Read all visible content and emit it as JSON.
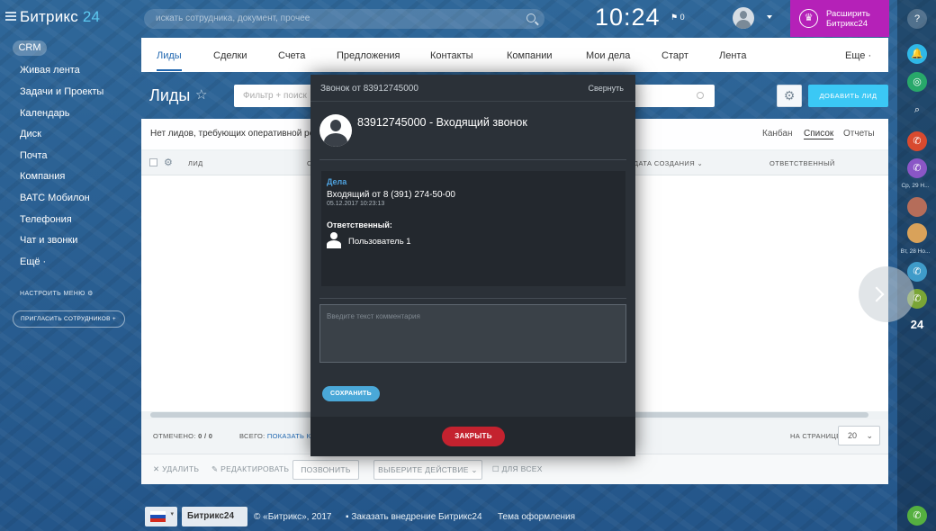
{
  "top_bar": {
    "logo_text": "Битрикс",
    "logo_num": "24",
    "search_placeholder": "искать сотрудника, документ, прочее",
    "clock": "10:24",
    "flag_count": "0",
    "upgrade_line1": "Расширить",
    "upgrade_line2": "Битрикс24",
    "upgrade_color": "#b521b8"
  },
  "sidebar": {
    "crm": "CRM",
    "items": [
      {
        "label": "Живая лента"
      },
      {
        "label": "Задачи и Проекты"
      },
      {
        "label": "Календарь"
      },
      {
        "label": "Диск"
      },
      {
        "label": "Почта"
      },
      {
        "label": "Компания"
      },
      {
        "label": "ВАТС Мобилон"
      },
      {
        "label": "Телефония"
      },
      {
        "label": "Чат и звонки"
      },
      {
        "label": "Ещё ·"
      }
    ],
    "configure_menu": "НАСТРОИТЬ МЕНЮ",
    "invite": "ПРИГЛАСИТЬ СОТРУДНИКОВ"
  },
  "tabs": {
    "items": [
      "Лиды",
      "Сделки",
      "Счета",
      "Предложения",
      "Контакты",
      "Компании",
      "Мои дела",
      "Старт",
      "Лента"
    ],
    "more": "Еще ·",
    "active": "Лиды"
  },
  "page": {
    "title": "Лиды",
    "filter_placeholder": "Фильтр + поиск",
    "add_lead": "ДОБАВИТЬ ЛИД",
    "notice": "Нет лидов, требующих оперативной ре",
    "views": [
      "Канбан",
      "Список",
      "Отчеты"
    ],
    "active_view": "Список"
  },
  "table": {
    "columns": [
      "ЛИД",
      "С",
      "ДАТА СОЗДАНИЯ",
      "ОТВЕТСТВЕННЫЙ"
    ],
    "selected_label": "ОТМЕЧЕНО:",
    "selected_value": "0 / 0",
    "total_label": "ВСЕГО:",
    "show_count": "ПОКАЗАТЬ КОЛ",
    "per_page_label": "НА СТРАНИЦЕ:",
    "per_page_value": "20"
  },
  "actions": {
    "delete": "УДАЛИТЬ",
    "edit": "РЕДАКТИРОВАТЬ",
    "call": "ПОЗВОНИТЬ",
    "choose_action": "ВЫБЕРИТЕ ДЕЙСТВИЕ",
    "for_all": "ДЛЯ ВСЕХ"
  },
  "footer": {
    "brand": "Битрикс24",
    "copyright": "© «Битрикс», 2017",
    "order": "Заказать внедрение Битрикс24",
    "theme": "Тема оформления"
  },
  "dock": {
    "help": "?",
    "date1": "Ср, 29 Н...",
    "date2": "Вт, 28 Но...",
    "b24": "24"
  },
  "call_modal": {
    "header_title": "Звонок от 83912745000",
    "collapse": "Свернуть",
    "caller_line": "83912745000 - Входящий звонок",
    "deals_title": "Дела",
    "deal_text": "Входящий от 8 (391) 274-50-00",
    "deal_date": "05.12.2017 10:23:13",
    "responsible_label": "Ответственный:",
    "responsible_name": "Пользователь 1",
    "comment_placeholder": "Введите текст комментария",
    "save": "СОХРАНИТЬ",
    "close": "ЗАКРЫТЬ",
    "close_color": "#c4222f"
  }
}
